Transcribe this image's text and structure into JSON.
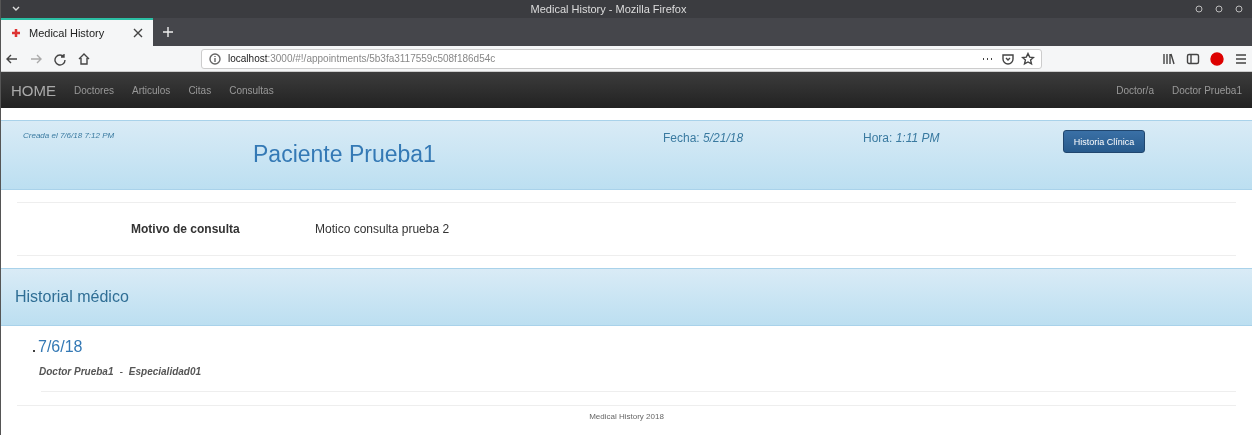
{
  "window": {
    "title": "Medical History - Mozilla Firefox"
  },
  "tabs": [
    {
      "label": "Medical History",
      "selected": true
    }
  ],
  "address_bar": {
    "host": "localhost",
    "path": ":3000/#!/appointments/5b3fa3117559c508f186d54c"
  },
  "navbar": {
    "brand": "HOME",
    "items": [
      "Doctores",
      "Articulos",
      "Citas",
      "Consultas"
    ],
    "right_items": [
      "Doctor/a",
      "Doctor Prueba1"
    ]
  },
  "appointment": {
    "created": "Creada el 7/6/18 7:12 PM",
    "patient": "Paciente Prueba1",
    "date": "Fecha: *5/21/18*",
    "time": "Hora: *1:11 PM*",
    "button": "Historia Clínica"
  },
  "reason": {
    "label": "Motivo de consulta",
    "value": "Motico consulta prueba 2"
  },
  "history": {
    "title": "Historial médico",
    "entries": [
      {
        "date": "7/6/18",
        "doctor": "Doctor Prueba1",
        "separator": "-",
        "specialty": "Especialidad01"
      }
    ]
  },
  "footer": "Medical History 2018"
}
